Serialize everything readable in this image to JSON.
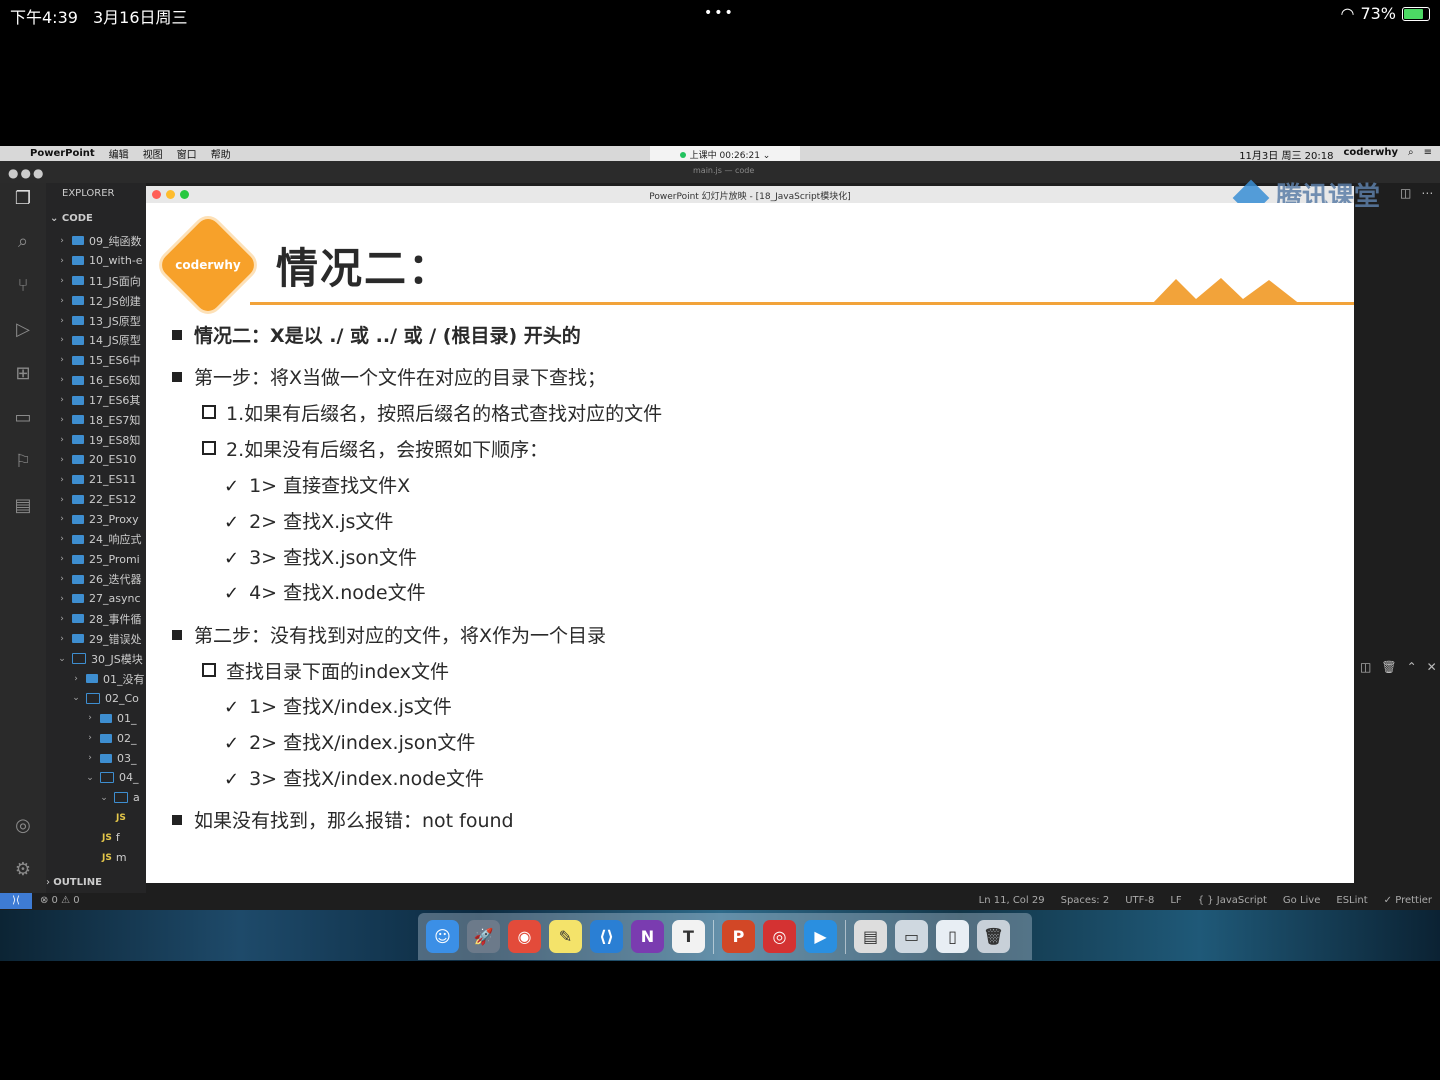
{
  "ipad_status": {
    "time": "下午4:39",
    "date": "3月16日周三",
    "dots": "•••",
    "battery": "73%",
    "battery_level": 0.73
  },
  "mac_menubar": {
    "app": "PowerPoint",
    "menus": [
      "编辑",
      "视图",
      "窗口",
      "帮助"
    ],
    "live_status": "上课中 00:26:21 ⌄",
    "datetime": "11月3日 周三 20:18",
    "user": "coderwhy"
  },
  "vscode": {
    "window_title": "main.js — code",
    "explorer_label": "EXPLORER",
    "workspace_label": "CODE",
    "outline_label": "OUTLINE",
    "tree": [
      {
        "label": "09_纯函数",
        "depth": 0,
        "type": "folder"
      },
      {
        "label": "10_with-e",
        "depth": 0,
        "type": "folder"
      },
      {
        "label": "11_JS面向",
        "depth": 0,
        "type": "folder"
      },
      {
        "label": "12_JS创建",
        "depth": 0,
        "type": "folder"
      },
      {
        "label": "13_JS原型",
        "depth": 0,
        "type": "folder"
      },
      {
        "label": "14_JS原型",
        "depth": 0,
        "type": "folder"
      },
      {
        "label": "15_ES6中",
        "depth": 0,
        "type": "folder"
      },
      {
        "label": "16_ES6知",
        "depth": 0,
        "type": "folder"
      },
      {
        "label": "17_ES6其",
        "depth": 0,
        "type": "folder"
      },
      {
        "label": "18_ES7知",
        "depth": 0,
        "type": "folder"
      },
      {
        "label": "19_ES8知",
        "depth": 0,
        "type": "folder"
      },
      {
        "label": "20_ES10",
        "depth": 0,
        "type": "folder"
      },
      {
        "label": "21_ES11",
        "depth": 0,
        "type": "folder"
      },
      {
        "label": "22_ES12",
        "depth": 0,
        "type": "folder"
      },
      {
        "label": "23_Proxy",
        "depth": 0,
        "type": "folder"
      },
      {
        "label": "24_响应式",
        "depth": 0,
        "type": "folder"
      },
      {
        "label": "25_Promi",
        "depth": 0,
        "type": "folder"
      },
      {
        "label": "26_迭代器",
        "depth": 0,
        "type": "folder"
      },
      {
        "label": "27_async",
        "depth": 0,
        "type": "folder"
      },
      {
        "label": "28_事件循",
        "depth": 0,
        "type": "folder"
      },
      {
        "label": "29_错误处",
        "depth": 0,
        "type": "folder"
      },
      {
        "label": "30_JS模块",
        "depth": 0,
        "type": "folder-open"
      },
      {
        "label": "01_没有",
        "depth": 1,
        "type": "folder"
      },
      {
        "label": "02_Co",
        "depth": 1,
        "type": "folder-open"
      },
      {
        "label": "01_",
        "depth": 2,
        "type": "folder"
      },
      {
        "label": "02_",
        "depth": 2,
        "type": "folder"
      },
      {
        "label": "03_",
        "depth": 2,
        "type": "folder"
      },
      {
        "label": "04_",
        "depth": 2,
        "type": "folder-open"
      },
      {
        "label": "a",
        "depth": 3,
        "type": "folder-open"
      },
      {
        "label": "",
        "depth": 4,
        "type": "js"
      },
      {
        "label": "f",
        "depth": 3,
        "type": "js"
      },
      {
        "label": "m",
        "depth": 3,
        "type": "js"
      }
    ],
    "status": {
      "problems": "⊗ 0 ⚠ 0",
      "position": "Ln 11, Col 29",
      "spaces": "Spaces: 2",
      "encoding": "UTF-8",
      "eol": "LF",
      "language": "{ } JavaScript",
      "golive": "Go Live",
      "eslint": "ESLint",
      "prettier": "✓ Prettier"
    }
  },
  "watermark": "腾讯课堂",
  "ppt": {
    "window_title": "PowerPoint 幻灯片放映 - [18_JavaScript模块化]",
    "logo_text": "coderwhy",
    "slide_title": "情况二：",
    "lines": [
      {
        "kind": "square",
        "bold": true,
        "text": "情况二：X是以 ./ 或 ../ 或 / (根目录) 开头的"
      },
      {
        "kind": "square",
        "bold": false,
        "text": "第一步：将X当做一个文件在对应的目录下查找；"
      },
      {
        "kind": "box",
        "bold": false,
        "text": "1.如果有后缀名，按照后缀名的格式查找对应的文件"
      },
      {
        "kind": "box",
        "bold": false,
        "text": "2.如果没有后缀名，会按照如下顺序："
      },
      {
        "kind": "check",
        "bold": false,
        "text": "1> 直接查找文件X"
      },
      {
        "kind": "check",
        "bold": false,
        "text": "2> 查找X.js文件"
      },
      {
        "kind": "check",
        "bold": false,
        "text": "3> 查找X.json文件"
      },
      {
        "kind": "check",
        "bold": false,
        "text": "4> 查找X.node文件"
      },
      {
        "kind": "square",
        "bold": false,
        "text": "第二步：没有找到对应的文件，将X作为一个目录"
      },
      {
        "kind": "box",
        "bold": false,
        "text": "查找目录下面的index文件"
      },
      {
        "kind": "check",
        "bold": false,
        "text": "1> 查找X/index.js文件"
      },
      {
        "kind": "check",
        "bold": false,
        "text": "2> 查找X/index.json文件"
      },
      {
        "kind": "check",
        "bold": false,
        "text": "3> 查找X/index.node文件"
      },
      {
        "kind": "square",
        "bold": false,
        "text": "如果没有找到，那么报错：not found"
      }
    ]
  },
  "dock": [
    {
      "name": "finder",
      "glyph": "☺",
      "color": "#3b8fe6"
    },
    {
      "name": "launchpad",
      "glyph": "🚀",
      "color": "#6c7a8a"
    },
    {
      "name": "chrome",
      "glyph": "◉",
      "color": "#e34b3a"
    },
    {
      "name": "notes",
      "glyph": "✎",
      "color": "#f4e36a"
    },
    {
      "name": "vscode",
      "glyph": "⟨⟩",
      "color": "#2a7fd4"
    },
    {
      "name": "onenote",
      "glyph": "N",
      "color": "#7a3cb0"
    },
    {
      "name": "typora",
      "glyph": "T",
      "color": "#f2f2f2"
    },
    {
      "name": "powerpoint",
      "glyph": "P",
      "color": "#d24726"
    },
    {
      "name": "netease-music",
      "glyph": "◎",
      "color": "#d43232"
    },
    {
      "name": "tencent-classroom",
      "glyph": "▶",
      "color": "#2a8fe0"
    },
    {
      "name": "preview",
      "glyph": "▤",
      "color": "#dddddd"
    },
    {
      "name": "screenshot",
      "glyph": "▭",
      "color": "#cfd8e0"
    },
    {
      "name": "document",
      "glyph": "▯",
      "color": "#e8eef4"
    },
    {
      "name": "trash",
      "glyph": "🗑",
      "color": "#c8d0d8"
    }
  ]
}
